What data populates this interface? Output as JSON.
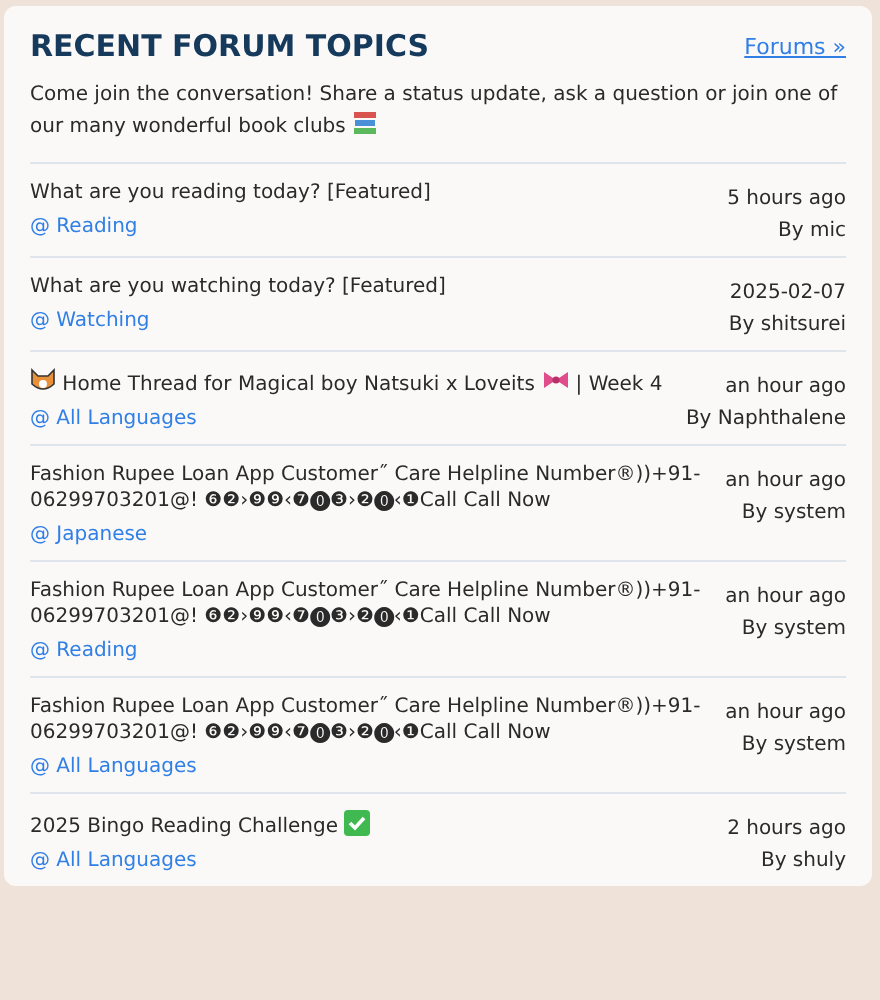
{
  "header": {
    "title": "RECENT FORUM TOPICS",
    "link": "Forums »",
    "intro": "Come join the conversation! Share a status update, ask a question or join one of our many wonderful book clubs"
  },
  "topics": [
    {
      "title": [
        {
          "kind": "text",
          "text": "What are you reading today? [Featured]"
        }
      ],
      "group": "@ Reading",
      "time": "5 hours ago",
      "author": "By mic"
    },
    {
      "title": [
        {
          "kind": "text",
          "text": "What are you watching today? [Featured]"
        }
      ],
      "group": "@ Watching",
      "time": "2025-02-07",
      "author": "By shitsurei"
    },
    {
      "title": [
        {
          "kind": "critter"
        },
        {
          "kind": "text",
          "text": " Home Thread for Magical boy Natsuki x Loveits "
        },
        {
          "kind": "ribbon"
        },
        {
          "kind": "text",
          "text": " | Week 4"
        }
      ],
      "group": "@ All Languages",
      "time": "an hour ago",
      "author": "By Naphthalene"
    },
    {
      "title": [
        {
          "kind": "text",
          "text": "Fashion Rupee Loan App Customer˝ Care Helpline Number®))+91-06299703201@! ❻❷›❾❾‹❼⓿❸›❷⓿‹❶Call Call Now"
        }
      ],
      "group": "@ Japanese",
      "time": "an hour ago",
      "author": "By system"
    },
    {
      "title": [
        {
          "kind": "text",
          "text": "Fashion Rupee Loan App Customer˝ Care Helpline Number®))+91-06299703201@! ❻❷›❾❾‹❼⓿❸›❷⓿‹❶Call Call Now"
        }
      ],
      "group": "@ Reading",
      "time": "an hour ago",
      "author": "By system"
    },
    {
      "title": [
        {
          "kind": "text",
          "text": "Fashion Rupee Loan App Customer˝ Care Helpline Number®))+91-06299703201@! ❻❷›❾❾‹❼⓿❸›❷⓿‹❶Call Call Now"
        }
      ],
      "group": "@ All Languages",
      "time": "an hour ago",
      "author": "By system"
    },
    {
      "title": [
        {
          "kind": "text",
          "text": "2025 Bingo Reading Challenge "
        },
        {
          "kind": "check"
        }
      ],
      "group": "@ All Languages",
      "time": "2 hours ago",
      "author": "By shuly"
    }
  ]
}
